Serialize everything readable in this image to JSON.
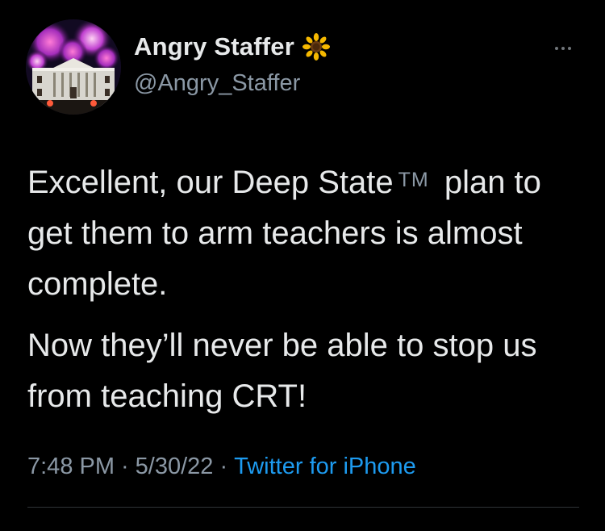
{
  "tweet": {
    "author": {
      "display_name": "Angry Staffer",
      "name_emoji_icon": "sunflower-icon",
      "handle": "@Angry_Staffer",
      "avatar_icon": "white-house-fireworks-avatar"
    },
    "more_icon": "more-dots-icon",
    "body": {
      "para1_before_tm": "Excellent, our Deep State",
      "trademark": "TM",
      "para1_after_tm": " plan to get them to arm teachers is almost complete.",
      "para2": "Now they’ll never be able to stop us from teaching CRT!"
    },
    "meta": {
      "time": "7:48 PM",
      "separator": "·",
      "date": "5/30/22",
      "source": "Twitter for iPhone"
    }
  },
  "colors": {
    "background": "#000000",
    "primary_text": "#e7e9ea",
    "secondary_text": "#8b98a5",
    "link": "#1d9bf0",
    "divider": "#2f3336"
  }
}
